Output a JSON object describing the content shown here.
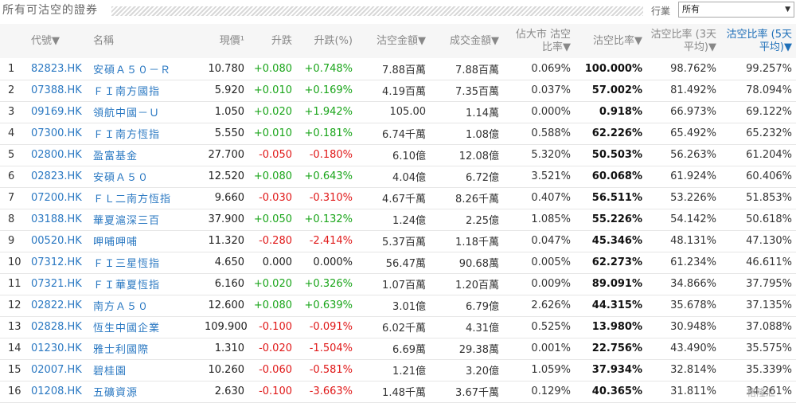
{
  "page_title": "所有可沽空的證券",
  "industry": {
    "label": "行業",
    "selected": "所有",
    "arrow": "▼"
  },
  "columns": [
    {
      "key": "code",
      "label": "代號▼"
    },
    {
      "key": "name",
      "label": "名稱"
    },
    {
      "key": "price",
      "label": "現價¹"
    },
    {
      "key": "change",
      "label": "升跌"
    },
    {
      "key": "pct",
      "label": "升跌(%)"
    },
    {
      "key": "short_amt",
      "label": "沽空金額▼"
    },
    {
      "key": "turnover",
      "label": "成交金額▼"
    },
    {
      "key": "mcap_ratio",
      "label": "佔大市 沽空比率▼"
    },
    {
      "key": "short_ratio",
      "label": "沽空比率▼"
    },
    {
      "key": "ratio3",
      "label": "沽空比率 (3天平均)▼"
    },
    {
      "key": "ratio5",
      "label": "沽空比率 (5天平均)▼"
    }
  ],
  "rows": [
    {
      "idx": "1",
      "code": "82823.HK",
      "name": "安碩Ａ５０－Ｒ",
      "price": "10.780",
      "change": "+0.080",
      "pct": "+0.748%",
      "dir": "up",
      "short_amt": "7.88百萬",
      "turnover": "7.88百萬",
      "mcap_ratio": "0.069%",
      "short_ratio": "100.000%",
      "ratio3": "98.762%",
      "ratio5": "99.257%"
    },
    {
      "idx": "2",
      "code": "07388.HK",
      "name": "ＦＩ南方國指",
      "price": "5.920",
      "change": "+0.010",
      "pct": "+0.169%",
      "dir": "up",
      "short_amt": "4.19百萬",
      "turnover": "7.35百萬",
      "mcap_ratio": "0.037%",
      "short_ratio": "57.002%",
      "ratio3": "81.492%",
      "ratio5": "78.094%"
    },
    {
      "idx": "3",
      "code": "09169.HK",
      "name": "領航中國－Ｕ",
      "price": "1.050",
      "change": "+0.020",
      "pct": "+1.942%",
      "dir": "up",
      "short_amt": "105.00",
      "turnover": "1.14萬",
      "mcap_ratio": "0.000%",
      "short_ratio": "0.918%",
      "ratio3": "66.973%",
      "ratio5": "69.122%"
    },
    {
      "idx": "4",
      "code": "07300.HK",
      "name": "ＦＩ南方恆指",
      "price": "5.550",
      "change": "+0.010",
      "pct": "+0.181%",
      "dir": "up",
      "short_amt": "6.74千萬",
      "turnover": "1.08億",
      "mcap_ratio": "0.588%",
      "short_ratio": "62.226%",
      "ratio3": "65.492%",
      "ratio5": "65.232%"
    },
    {
      "idx": "5",
      "code": "02800.HK",
      "name": "盈富基金",
      "price": "27.700",
      "change": "-0.050",
      "pct": "-0.180%",
      "dir": "down",
      "short_amt": "6.10億",
      "turnover": "12.08億",
      "mcap_ratio": "5.320%",
      "short_ratio": "50.503%",
      "ratio3": "56.263%",
      "ratio5": "61.204%"
    },
    {
      "idx": "6",
      "code": "02823.HK",
      "name": "安碩Ａ５０",
      "price": "12.520",
      "change": "+0.080",
      "pct": "+0.643%",
      "dir": "up",
      "short_amt": "4.04億",
      "turnover": "6.72億",
      "mcap_ratio": "3.521%",
      "short_ratio": "60.068%",
      "ratio3": "61.924%",
      "ratio5": "60.406%"
    },
    {
      "idx": "7",
      "code": "07200.HK",
      "name": "ＦＬ二南方恆指",
      "price": "9.660",
      "change": "-0.030",
      "pct": "-0.310%",
      "dir": "down",
      "short_amt": "4.67千萬",
      "turnover": "8.26千萬",
      "mcap_ratio": "0.407%",
      "short_ratio": "56.511%",
      "ratio3": "53.226%",
      "ratio5": "51.853%"
    },
    {
      "idx": "8",
      "code": "03188.HK",
      "name": "華夏滬深三百",
      "price": "37.900",
      "change": "+0.050",
      "pct": "+0.132%",
      "dir": "up",
      "short_amt": "1.24億",
      "turnover": "2.25億",
      "mcap_ratio": "1.085%",
      "short_ratio": "55.226%",
      "ratio3": "54.142%",
      "ratio5": "50.618%"
    },
    {
      "idx": "9",
      "code": "00520.HK",
      "name": "呷哺呷哺",
      "price": "11.320",
      "change": "-0.280",
      "pct": "-2.414%",
      "dir": "down",
      "short_amt": "5.37百萬",
      "turnover": "1.18千萬",
      "mcap_ratio": "0.047%",
      "short_ratio": "45.346%",
      "ratio3": "48.131%",
      "ratio5": "47.130%"
    },
    {
      "idx": "10",
      "code": "07312.HK",
      "name": "ＦＩ三星恆指",
      "price": "4.650",
      "change": "0.000",
      "pct": "0.000%",
      "dir": "flat",
      "short_amt": "56.47萬",
      "turnover": "90.68萬",
      "mcap_ratio": "0.005%",
      "short_ratio": "62.273%",
      "ratio3": "61.234%",
      "ratio5": "46.611%"
    },
    {
      "idx": "11",
      "code": "07321.HK",
      "name": "ＦＩ華夏恆指",
      "price": "6.160",
      "change": "+0.020",
      "pct": "+0.326%",
      "dir": "up",
      "short_amt": "1.07百萬",
      "turnover": "1.20百萬",
      "mcap_ratio": "0.009%",
      "short_ratio": "89.091%",
      "ratio3": "34.866%",
      "ratio5": "37.795%"
    },
    {
      "idx": "12",
      "code": "02822.HK",
      "name": "南方Ａ５０",
      "price": "12.600",
      "change": "+0.080",
      "pct": "+0.639%",
      "dir": "up",
      "short_amt": "3.01億",
      "turnover": "6.79億",
      "mcap_ratio": "2.626%",
      "short_ratio": "44.315%",
      "ratio3": "35.678%",
      "ratio5": "37.135%"
    },
    {
      "idx": "13",
      "code": "02828.HK",
      "name": "恆生中國企業",
      "price": "109.900",
      "change": "-0.100",
      "pct": "-0.091%",
      "dir": "down",
      "short_amt": "6.02千萬",
      "turnover": "4.31億",
      "mcap_ratio": "0.525%",
      "short_ratio": "13.980%",
      "ratio3": "30.948%",
      "ratio5": "37.088%"
    },
    {
      "idx": "14",
      "code": "01230.HK",
      "name": "雅士利國際",
      "price": "1.310",
      "change": "-0.020",
      "pct": "-1.504%",
      "dir": "down",
      "short_amt": "6.69萬",
      "turnover": "29.38萬",
      "mcap_ratio": "0.001%",
      "short_ratio": "22.756%",
      "ratio3": "43.490%",
      "ratio5": "35.575%"
    },
    {
      "idx": "15",
      "code": "02007.HK",
      "name": "碧桂園",
      "price": "10.260",
      "change": "-0.060",
      "pct": "-0.581%",
      "dir": "down",
      "short_amt": "1.21億",
      "turnover": "3.20億",
      "mcap_ratio": "1.059%",
      "short_ratio": "37.934%",
      "ratio3": "32.814%",
      "ratio5": "35.339%"
    },
    {
      "idx": "16",
      "code": "01208.HK",
      "name": "五礦資源",
      "price": "2.630",
      "change": "-0.100",
      "pct": "-3.663%",
      "dir": "down",
      "short_amt": "1.48千萬",
      "turnover": "3.67千萬",
      "mcap_ratio": "0.129%",
      "short_ratio": "40.365%",
      "ratio3": "31.811%",
      "ratio5": "34.261%"
    }
  ],
  "watermark": "格隆汇"
}
